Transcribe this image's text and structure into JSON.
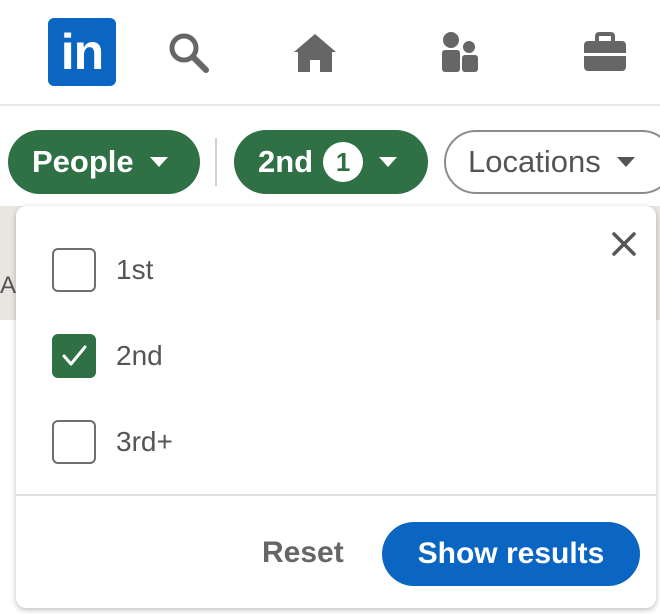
{
  "nav": {
    "logo_text": "in",
    "icons": [
      "search-icon",
      "home-icon",
      "my-network-icon",
      "jobs-icon"
    ]
  },
  "filters": {
    "people_label": "People",
    "degree_label": "2nd",
    "degree_count": "1",
    "locations_label": "Locations"
  },
  "background": {
    "partial_letter": "A"
  },
  "dropdown": {
    "options": [
      {
        "label": "1st",
        "checked": false
      },
      {
        "label": "2nd",
        "checked": true
      },
      {
        "label": "3rd+",
        "checked": false
      }
    ],
    "reset_label": "Reset",
    "show_results_label": "Show results"
  },
  "colors": {
    "brand": "#0a66c2",
    "active_filter": "#2f7045"
  }
}
